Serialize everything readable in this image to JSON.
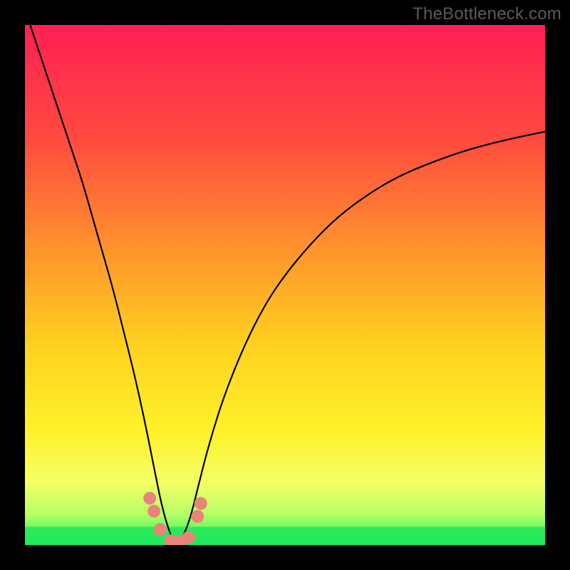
{
  "watermark": "TheBottleneck.com",
  "chart_data": {
    "type": "line",
    "title": "",
    "xlabel": "",
    "ylabel": "",
    "x_range": [
      0,
      100
    ],
    "y_range": [
      0,
      100
    ],
    "valley_x": 29,
    "series": [
      {
        "name": "bottleneck-curve",
        "x": [
          1,
          3,
          5,
          7,
          9,
          11,
          13,
          15,
          17,
          19,
          21,
          23,
          25,
          26,
          27,
          28,
          29,
          30,
          31,
          32,
          33,
          35,
          38,
          42,
          46,
          50,
          55,
          60,
          66,
          72,
          78,
          85,
          92,
          100
        ],
        "y": [
          100,
          94,
          88,
          82,
          76,
          70,
          63,
          56,
          49,
          41,
          33,
          24,
          14,
          9,
          5,
          2,
          0,
          1,
          3,
          6,
          10,
          18,
          28,
          38,
          46,
          52,
          58,
          63,
          67.5,
          71,
          73.5,
          76,
          77.8,
          79.5
        ]
      }
    ],
    "markers": {
      "name": "salmon-dots",
      "color": "#e9847a",
      "points_xy": [
        [
          24.0,
          9.0
        ],
        [
          24.8,
          6.5
        ],
        [
          26.0,
          3.0
        ],
        [
          28.0,
          0.8
        ],
        [
          30.0,
          0.8
        ],
        [
          31.5,
          1.5
        ],
        [
          33.2,
          5.5
        ],
        [
          33.8,
          8.0
        ]
      ]
    },
    "gradient_stops": [
      {
        "pct": 0,
        "color": "#ff1f55"
      },
      {
        "pct": 22,
        "color": "#ff4b3f"
      },
      {
        "pct": 45,
        "color": "#ff9a2a"
      },
      {
        "pct": 62,
        "color": "#ffd21f"
      },
      {
        "pct": 78,
        "color": "#fff22a"
      },
      {
        "pct": 88,
        "color": "#f4ff66"
      },
      {
        "pct": 94,
        "color": "#b6ff66"
      },
      {
        "pct": 100,
        "color": "#1fef5a"
      }
    ],
    "green_band": {
      "from_pct": 96.5,
      "to_pct": 100
    }
  }
}
